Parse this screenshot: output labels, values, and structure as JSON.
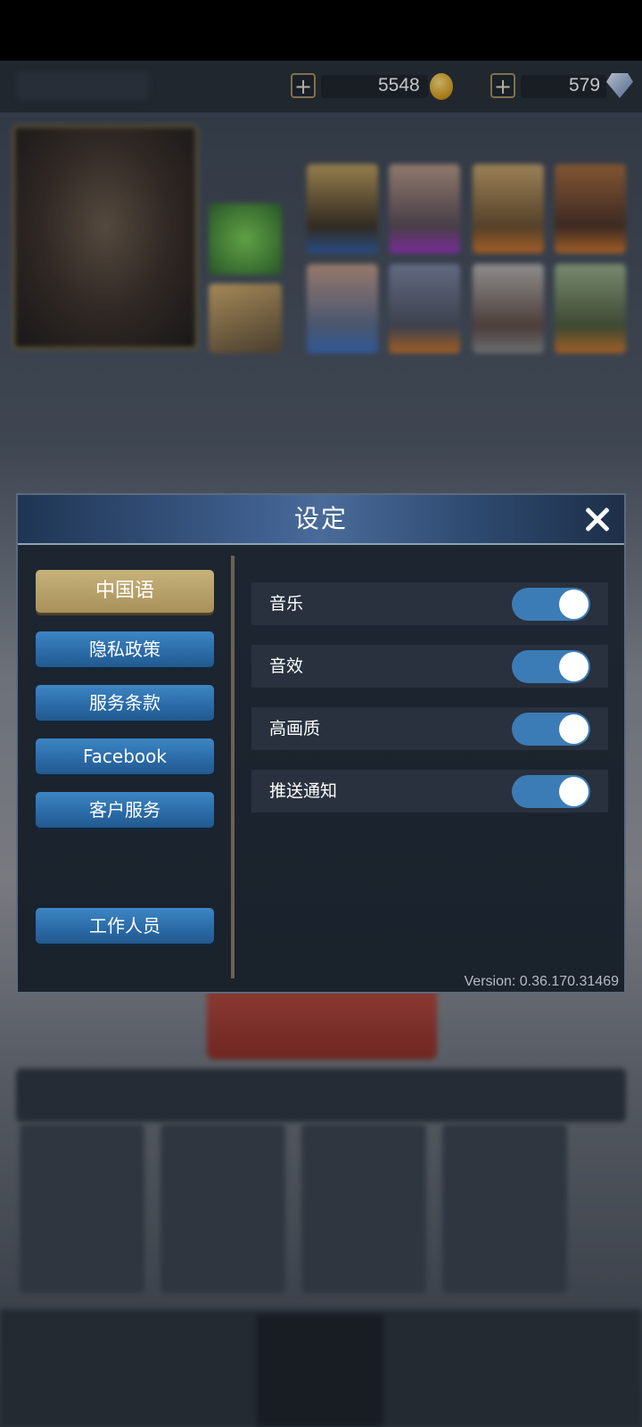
{
  "currency": {
    "gold": "5548",
    "gems": "579",
    "gold_icon": "gold-coin-icon",
    "gem_icon": "diamond-icon"
  },
  "dialog": {
    "title": "设定",
    "menu": [
      {
        "label": "中国语",
        "selected": true
      },
      {
        "label": "隐私政策"
      },
      {
        "label": "服务条款"
      },
      {
        "label": "Facebook"
      },
      {
        "label": "客户服务"
      },
      {
        "label": "工作人员"
      }
    ],
    "settings": [
      {
        "label": "音乐",
        "enabled": true
      },
      {
        "label": "音效",
        "enabled": true
      },
      {
        "label": "高画质",
        "enabled": true
      },
      {
        "label": "推送通知",
        "enabled": true
      }
    ],
    "version": "Version: 0.36.170.31469"
  },
  "colors": {
    "toggle_on": "#3c7cb6",
    "menu_button": "#2a6aa6",
    "menu_selected": "#b8a36a",
    "header": "#3f5f8e"
  }
}
